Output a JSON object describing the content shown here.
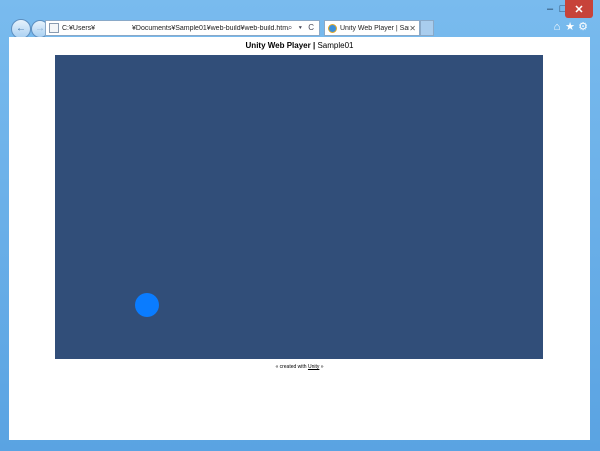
{
  "window": {
    "minimize_glyph": "–",
    "maximize_glyph": "□",
    "close_glyph": "✕"
  },
  "nav": {
    "back_glyph": "←",
    "forward_glyph": "→"
  },
  "address_bar": {
    "url": "C:¥Users¥                   ¥Documents¥Sample01¥web-build¥web-build.html",
    "tools": "⌕ ▾ C"
  },
  "tab": {
    "title": "Unity Web Player | Sam...",
    "close_glyph": "✕"
  },
  "toolbar": {
    "home_glyph": "⌂",
    "favorites_glyph": "★",
    "settings_glyph": "⚙"
  },
  "page": {
    "header_bold": "Unity Web Player",
    "header_sep": " | ",
    "header_title": "Sample01",
    "footer_prefix": "« created with ",
    "footer_link": "Unity",
    "footer_suffix": " »"
  },
  "colors": {
    "player_background": "#314e79",
    "ball": "#0a7cff",
    "frame": "#6fb2ea"
  }
}
